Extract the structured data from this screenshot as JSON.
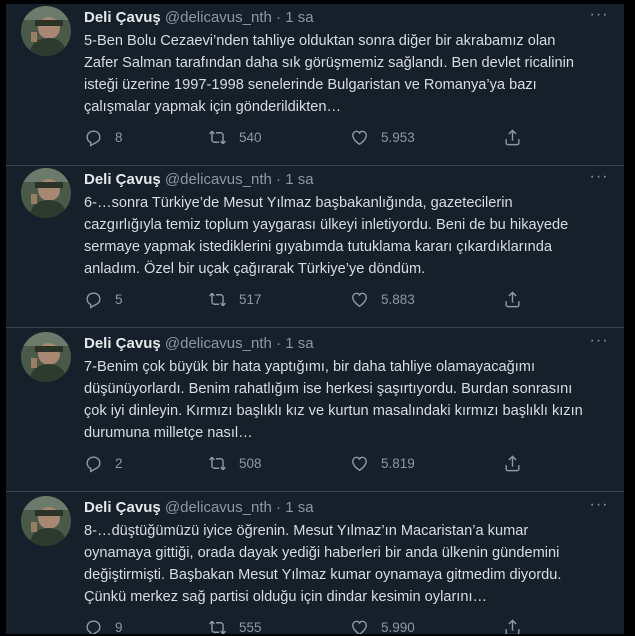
{
  "tweets": [
    {
      "name": "Deli Çavuş",
      "handle": "@delicavus_nth",
      "sep": "·",
      "time": "1 sa",
      "more": "···",
      "lines": [
        "5-Ben Bolu Cezaevi’nden tahliye olduktan sonra diğer bir akrabamız olan",
        "Zafer Salman tarafından daha sık görüşmemiz sağlandı. Ben devlet ricalinin",
        "isteği üzerine 1997-1998 senelerinde Bulgaristan ve Romanya’ya bazı",
        "çalışmalar yapmak için gönderildikten…"
      ],
      "replies": "8",
      "retweets": "540",
      "likes": "5.953"
    },
    {
      "name": "Deli Çavuş",
      "handle": "@delicavus_nth",
      "sep": "·",
      "time": "1 sa",
      "more": "···",
      "lines": [
        "6-…sonra Türkiye’de Mesut Yılmaz başbakanlığında, gazetecilerin",
        "cazgırlığıyla temiz toplum yaygarası ülkeyi inletiyordu. Beni de bu hikayede",
        "sermaye yapmak istediklerini gıyabımda tutuklama kararı çıkardıklarında",
        "anladım. Özel bir uçak çağırarak Türkiye’ye döndüm."
      ],
      "replies": "5",
      "retweets": "517",
      "likes": "5.883"
    },
    {
      "name": "Deli Çavuş",
      "handle": "@delicavus_nth",
      "sep": "·",
      "time": "1 sa",
      "more": "···",
      "lines": [
        "7-Benim çok büyük bir hata yaptığımı, bir daha tahliye olamayacağımı",
        "düşünüyorlardı. Benim rahatlığım ise herkesi şaşırtıyordu. Burdan sonrasını",
        "çok iyi dinleyin. Kırmızı başlıklı kız ve kurtun masalındaki kırmızı başlıklı kızın",
        "durumuna milletçe nasıl…"
      ],
      "replies": "2",
      "retweets": "508",
      "likes": "5.819"
    },
    {
      "name": "Deli Çavuş",
      "handle": "@delicavus_nth",
      "sep": "·",
      "time": "1 sa",
      "more": "···",
      "lines": [
        "8-…düştüğümüzü iyice öğrenin. Mesut Yılmaz’ın Macaristan’a kumar",
        "oynamaya gittiği, orada dayak yediği haberleri bir anda ülkenin gündemini",
        "değiştirmişti. Başbakan Mesut Yılmaz kumar oynamaya gitmedim diyordu.",
        "Çünkü merkez sağ partisi olduğu için dindar kesimin oylarını…"
      ],
      "replies": "9",
      "retweets": "555",
      "likes": "5.990"
    }
  ],
  "icons": {
    "reply": "reply-icon",
    "retweet": "retweet-icon",
    "like": "heart-icon",
    "share": "share-icon"
  },
  "colors": {
    "background": "#15202b",
    "divider": "#38444d",
    "muted": "#8b98a5",
    "text": "#d9dde0"
  }
}
